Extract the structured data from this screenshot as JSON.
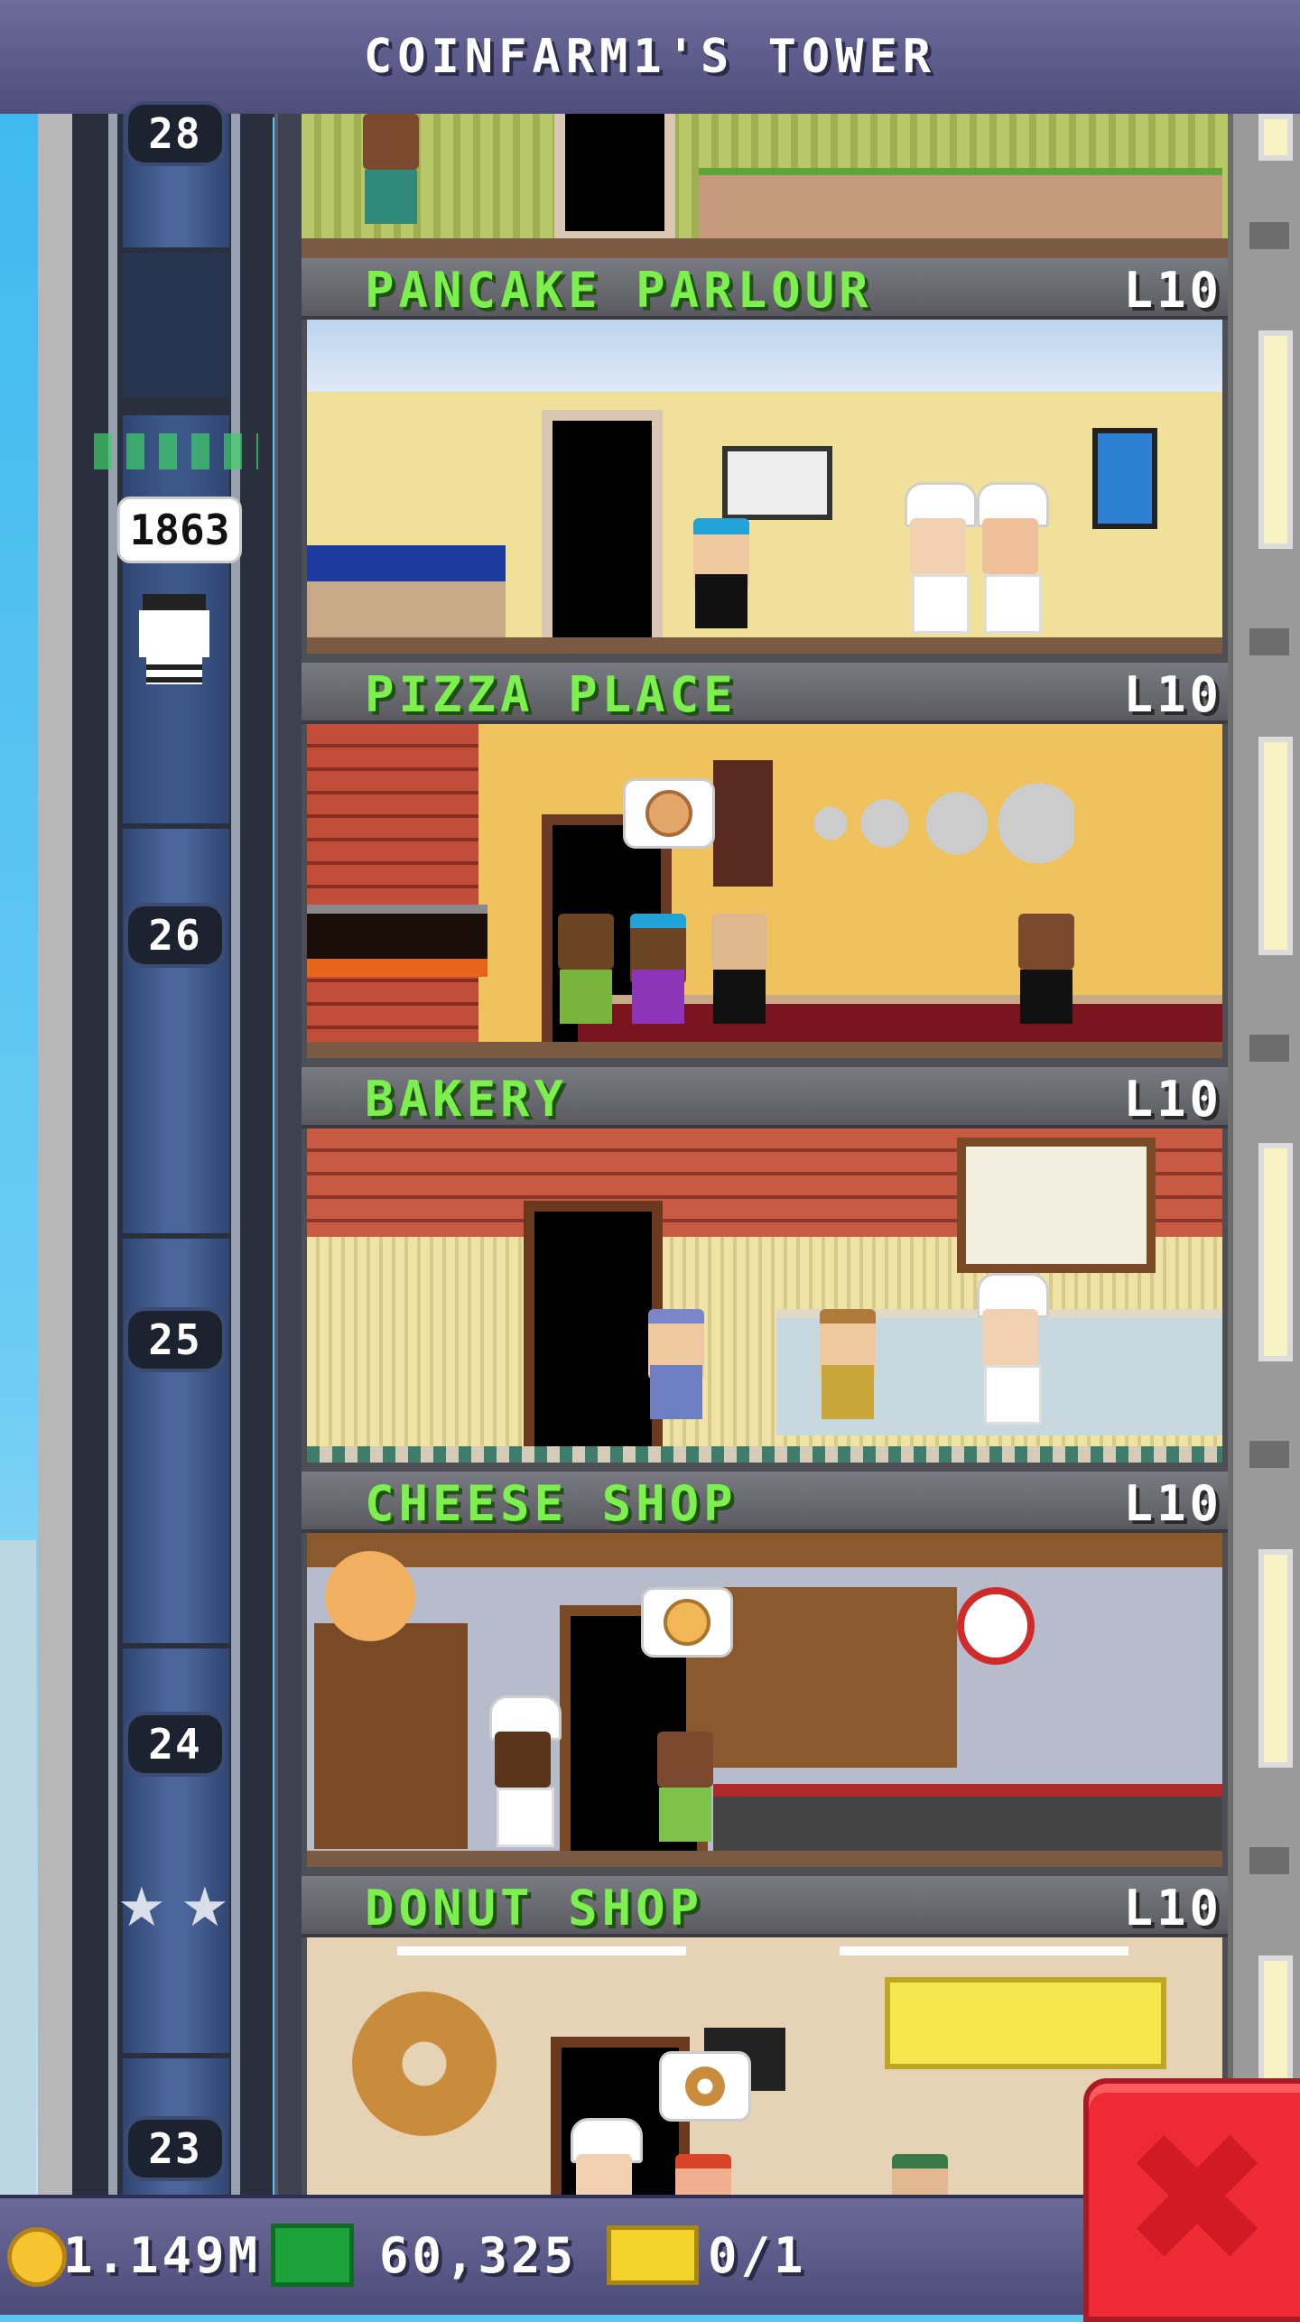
{
  "header": {
    "title": "COINFARM1'S TOWER"
  },
  "elevator": {
    "floor_numbers": [
      "28",
      "26",
      "25",
      "24",
      "23"
    ],
    "passenger_tip": "1863",
    "stars": 2
  },
  "floors": [
    {
      "name": "PANCAKE PARLOUR",
      "level": "L10"
    },
    {
      "name": "PIZZA PLACE",
      "level": "L10"
    },
    {
      "name": "BAKERY",
      "level": "L10"
    },
    {
      "name": "CHEESE SHOP",
      "level": "L10"
    },
    {
      "name": "DONUT SHOP",
      "level": "L10"
    }
  ],
  "status": {
    "coins": "1.149M",
    "bux": "60,325",
    "vip_tickets": "0/1"
  },
  "icons": {
    "coin": "coin-icon",
    "bux": "bitbux-icon",
    "ticket": "ticket-icon",
    "close": "close-icon",
    "star": "star-icon"
  },
  "colors": {
    "floor_name": "#7cf04c",
    "close_button": "#ee2b35",
    "header_bg": "#5e5d8c"
  }
}
